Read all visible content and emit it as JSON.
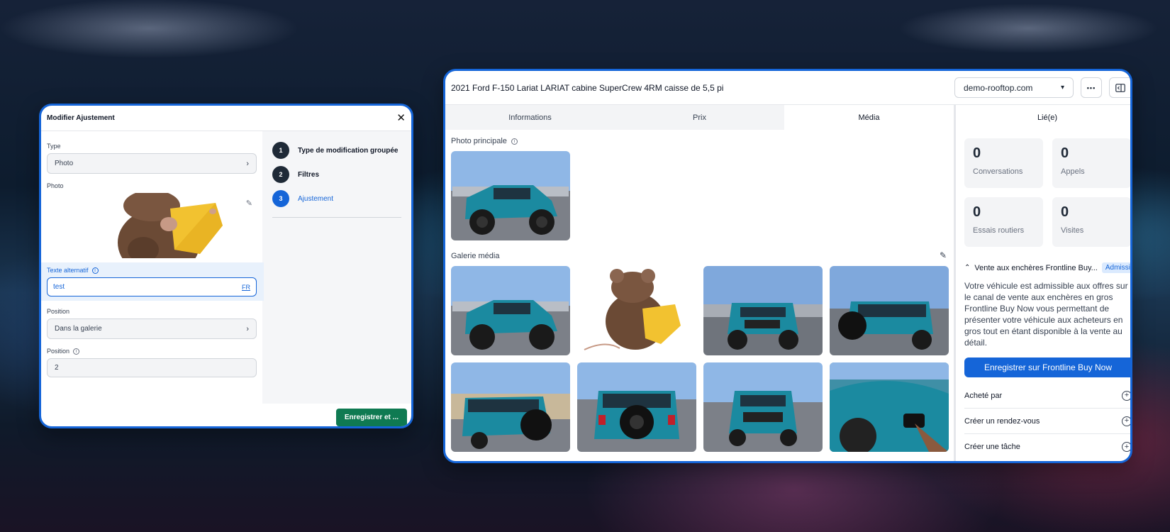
{
  "left_panel": {
    "title": "Modifier Ajustement",
    "type_label": "Type",
    "type_value": "Photo",
    "photo_label": "Photo",
    "alt_text_label": "Texte alternatif",
    "alt_text_value": "test",
    "alt_text_lang": "FR",
    "position_select_label": "Position",
    "position_select_value": "Dans la galerie",
    "position_input_label": "Position",
    "position_input_value": "2",
    "steps": [
      {
        "num": "1",
        "label": "Type de modification groupée"
      },
      {
        "num": "2",
        "label": "Filtres"
      },
      {
        "num": "3",
        "label": "Ajustement"
      }
    ],
    "save_label": "Enregistrer et ..."
  },
  "right_panel": {
    "title": "2021 Ford F-150 Lariat LARIAT cabine SuperCrew 4RM caisse de 5,5 pi",
    "domain": "demo-rooftop.com",
    "more_label": "•••",
    "tabs": [
      "Informations",
      "Prix",
      "Média"
    ],
    "active_tab": "Média",
    "main_photo_label": "Photo principale",
    "gallery_label": "Galerie média",
    "side": {
      "title": "Lié(e)",
      "stats": [
        {
          "value": "0",
          "label": "Conversations"
        },
        {
          "value": "0",
          "label": "Appels"
        },
        {
          "value": "0",
          "label": "Essais routiers"
        },
        {
          "value": "0",
          "label": "Visites"
        }
      ],
      "auction_title": "Vente aux enchères Frontline Buy...",
      "auction_badge": "Admissi",
      "auction_text": "Votre véhicule est admissible aux offres sur le canal de vente aux enchères en gros Frontline Buy Now vous permettant de présenter votre véhicule aux acheteurs en gros tout en étant disponible à la vente au détail.",
      "buy_button": "Enregistrer sur Frontline Buy Now",
      "rows": [
        "Acheté par",
        "Créer un rendez-vous",
        "Créer une tâche"
      ]
    }
  },
  "colors": {
    "accent": "#1565d8",
    "save_green": "#0f7a52",
    "jeep_teal": "#1b8aa0"
  }
}
